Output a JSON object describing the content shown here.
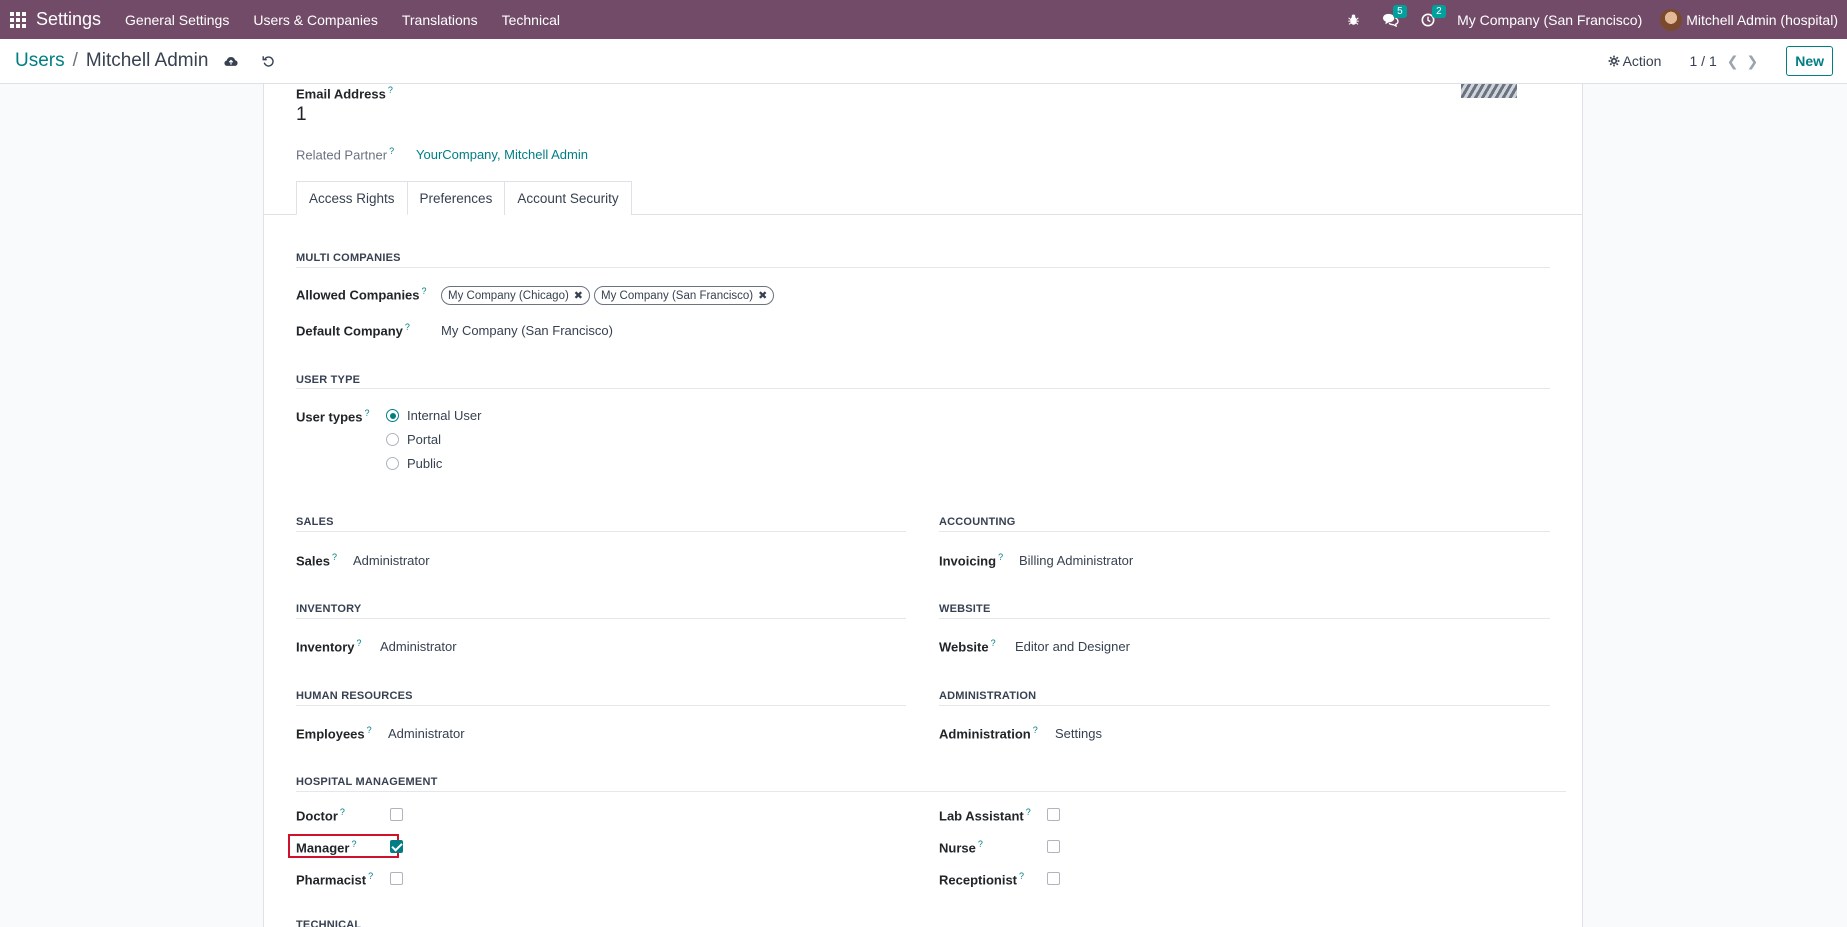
{
  "navbar": {
    "app_name": "Settings",
    "menu": [
      "General Settings",
      "Users & Companies",
      "Translations",
      "Technical"
    ],
    "messages_count": "5",
    "activities_count": "2",
    "company": "My Company (San Francisco)",
    "user": "Mitchell Admin (hospital)"
  },
  "control_panel": {
    "breadcrumb_parent": "Users",
    "breadcrumb_sep": "/",
    "breadcrumb_current": "Mitchell Admin",
    "action_label": "Action",
    "pager": "1 / 1",
    "new_label": "New"
  },
  "form": {
    "email_label": "Email Address",
    "email_value": "1",
    "related_partner_label": "Related Partner",
    "related_partner_value": "YourCompany, Mitchell Admin",
    "help_mark": "?"
  },
  "tabs": [
    "Access Rights",
    "Preferences",
    "Account Security"
  ],
  "multi_companies": {
    "title": "MULTI COMPANIES",
    "allowed_label": "Allowed Companies",
    "allowed": [
      "My Company (Chicago)",
      "My Company (San Francisco)"
    ],
    "default_label": "Default Company",
    "default_value": "My Company (San Francisco)"
  },
  "user_type": {
    "title": "USER TYPE",
    "label": "User types",
    "options": [
      "Internal User",
      "Portal",
      "Public"
    ],
    "selected": "Internal User"
  },
  "groups": {
    "sales": {
      "title": "SALES",
      "label": "Sales",
      "value": "Administrator"
    },
    "accounting": {
      "title": "ACCOUNTING",
      "label": "Invoicing",
      "value": "Billing Administrator"
    },
    "inventory": {
      "title": "INVENTORY",
      "label": "Inventory",
      "value": "Administrator"
    },
    "website": {
      "title": "WEBSITE",
      "label": "Website",
      "value": "Editor and Designer"
    },
    "hr": {
      "title": "HUMAN RESOURCES",
      "label": "Employees",
      "value": "Administrator"
    },
    "administration": {
      "title": "ADMINISTRATION",
      "label": "Administration",
      "value": "Settings"
    }
  },
  "hospital": {
    "title": "HOSPITAL MANAGEMENT",
    "doctor": {
      "label": "Doctor",
      "checked": false
    },
    "manager": {
      "label": "Manager",
      "checked": true
    },
    "pharmacist": {
      "label": "Pharmacist",
      "checked": false
    },
    "lab_assistant": {
      "label": "Lab Assistant",
      "checked": false
    },
    "nurse": {
      "label": "Nurse",
      "checked": false
    },
    "receptionist": {
      "label": "Receptionist",
      "checked": false
    }
  },
  "technical": {
    "title": "TECHNICAL"
  },
  "colors": {
    "navbar": "#714b67",
    "accent": "#017e84",
    "highlight": "#d0112b"
  }
}
